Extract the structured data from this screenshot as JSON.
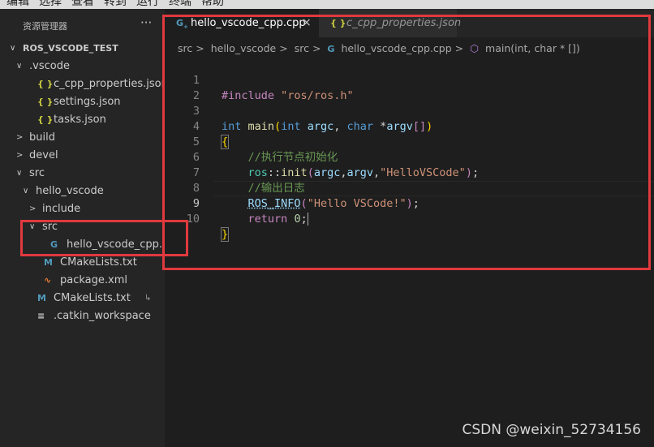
{
  "menu": [
    "编辑",
    "选择",
    "查看",
    "转到",
    "运行",
    "终端",
    "帮助"
  ],
  "explorer": {
    "title": "资源管理器",
    "more": "···",
    "tree": [
      {
        "label": "ROS_VSCODE_TEST",
        "depth": 0,
        "chevron": "v",
        "icon": "",
        "root": true
      },
      {
        "label": ".vscode",
        "depth": 1,
        "chevron": "v",
        "icon": ""
      },
      {
        "label": "c_cpp_properties.json",
        "depth": 2,
        "chevron": "",
        "icon": "{}"
      },
      {
        "label": "settings.json",
        "depth": 2,
        "chevron": "",
        "icon": "{}"
      },
      {
        "label": "tasks.json",
        "depth": 2,
        "chevron": "",
        "icon": "{}"
      },
      {
        "label": "build",
        "depth": 1,
        "chevron": ">",
        "icon": ""
      },
      {
        "label": "devel",
        "depth": 1,
        "chevron": ">",
        "icon": ""
      },
      {
        "label": "src",
        "depth": 1,
        "chevron": "v",
        "icon": ""
      },
      {
        "label": "hello_vscode",
        "depth": 2,
        "chevron": "v",
        "icon": ""
      },
      {
        "label": "include",
        "depth": 3,
        "chevron": ">",
        "icon": ""
      },
      {
        "label": "src",
        "depth": 3,
        "chevron": "v",
        "icon": ""
      },
      {
        "label": "hello_vscode_cpp.cpp",
        "depth": 4,
        "chevron": "",
        "icon": "G"
      },
      {
        "label": "CMakeLists.txt",
        "depth": 3,
        "chevron": "",
        "icon": "M"
      },
      {
        "label": "package.xml",
        "depth": 3,
        "chevron": "",
        "icon": "rss"
      },
      {
        "label": "CMakeLists.txt",
        "depth": 2,
        "chevron": "",
        "icon": "M",
        "badge": "↳"
      },
      {
        "label": ".catkin_workspace",
        "depth": 2,
        "chevron": "",
        "icon": "≡"
      }
    ]
  },
  "tabs": [
    {
      "label": "hello_vscode_cpp.cpp",
      "icon": "G",
      "close": "×"
    },
    {
      "label": "c_cpp_properties.json",
      "icon": "{ }"
    }
  ],
  "breadcrumbs": [
    "src",
    "hello_vscode",
    "src",
    "hello_vscode_cpp.cpp",
    "main(int, char * [])"
  ],
  "breadcrumb_sep": ">",
  "code": {
    "line_numbers": [
      "1",
      "2",
      "3",
      "4",
      "5",
      "6",
      "7",
      "8",
      "9",
      "10"
    ],
    "active_line": "9"
  },
  "watermark": "CSDN @weixin_52734156",
  "colors": {
    "accent_box": "#e0393e",
    "keyword": "#569cd6",
    "string": "#ce9178",
    "comment": "#6a9955"
  }
}
